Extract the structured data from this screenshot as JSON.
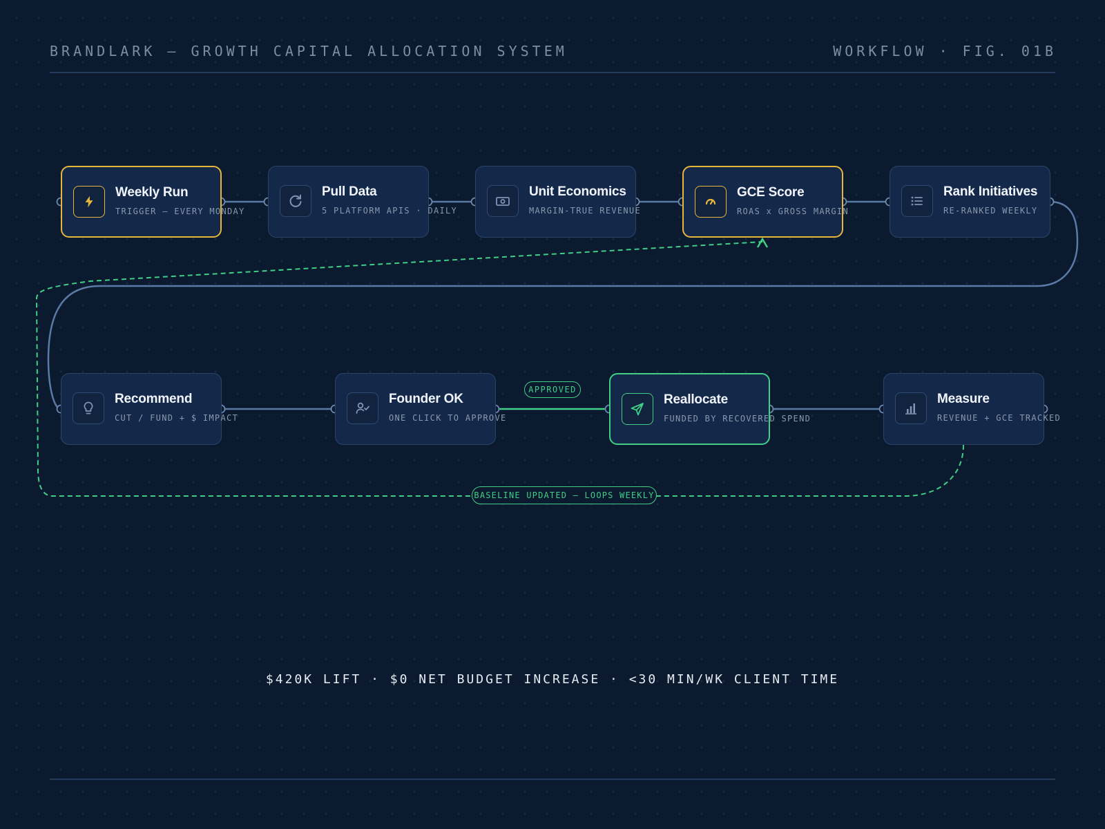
{
  "header": {
    "title": "BRANDLARK — GROWTH CAPITAL ALLOCATION SYSTEM",
    "figure": "WORKFLOW · FIG. 01B"
  },
  "nodes": [
    {
      "title": "Weekly Run",
      "subtitle": "TRIGGER — EVERY MONDAY",
      "icon": "lightning-icon"
    },
    {
      "title": "Pull Data",
      "subtitle": "5 PLATFORM APIS · DAILY",
      "icon": "refresh-icon"
    },
    {
      "title": "Unit Economics",
      "subtitle": "MARGIN-TRUE REVENUE",
      "icon": "cash-icon"
    },
    {
      "title": "GCE Score",
      "subtitle": "ROAS x GROSS MARGIN",
      "icon": "gauge-icon"
    },
    {
      "title": "Rank Initiatives",
      "subtitle": "RE-RANKED WEEKLY",
      "icon": "list-icon"
    },
    {
      "title": "Recommend",
      "subtitle": "CUT / FUND + $ IMPACT",
      "icon": "lightbulb-icon"
    },
    {
      "title": "Founder OK",
      "subtitle": "ONE CLICK TO APPROVE",
      "icon": "user-check-icon"
    },
    {
      "title": "Reallocate",
      "subtitle": "FUNDED BY RECOVERED SPEND",
      "icon": "send-icon"
    },
    {
      "title": "Measure",
      "subtitle": "REVENUE + GCE TRACKED",
      "icon": "bar-chart-icon"
    }
  ],
  "edge_labels": {
    "approved": "APPROVED",
    "loop": "BASELINE UPDATED — LOOPS WEEKLY"
  },
  "footer": {
    "stats": "$420K LIFT · $0 NET BUDGET INCREASE · <30 MIN/WK CLIENT TIME"
  },
  "colors": {
    "background": "#0b1a2f",
    "node_fill": "#14294a",
    "node_border": "#2a4468",
    "connector": "#5b7aa6",
    "highlight_gold": "#e8b63a",
    "highlight_green": "#3fcf86"
  }
}
